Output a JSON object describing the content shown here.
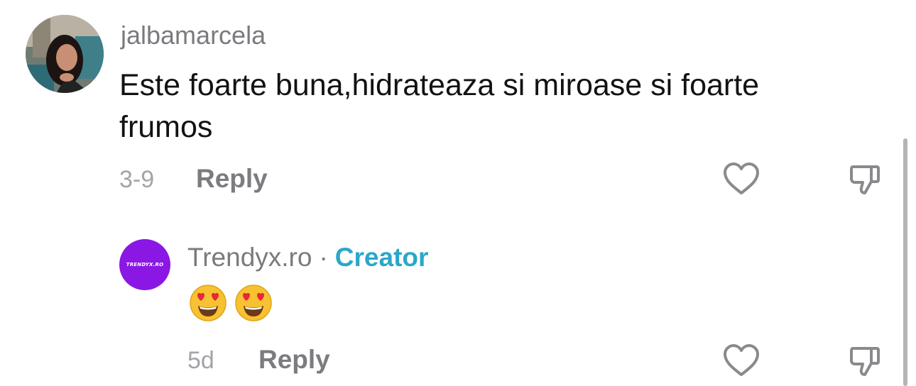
{
  "comment": {
    "username": "jalbamarcela",
    "text": "Este foarte buna,hidrateaza si miroase si foarte frumos",
    "date": "3-9",
    "reply_label": "Reply",
    "avatar_icon": "user-photo-avatar",
    "like_icon": "heart-outline-icon",
    "dislike_icon": "thumbs-down-outline-icon"
  },
  "reply": {
    "avatar_logo_text": "TRENDYX.RO",
    "author": "Trendyx.ro",
    "separator": "·",
    "badge": "Creator",
    "emojis": [
      "heart-eyes-emoji",
      "heart-eyes-emoji"
    ],
    "date": "5d",
    "reply_label": "Reply",
    "like_icon": "heart-outline-icon",
    "dislike_icon": "thumbs-down-outline-icon"
  },
  "colors": {
    "creator_badge": "#2aa7c9",
    "reply_avatar_bg": "#8a17e3",
    "muted_text": "#7a7a7f"
  }
}
